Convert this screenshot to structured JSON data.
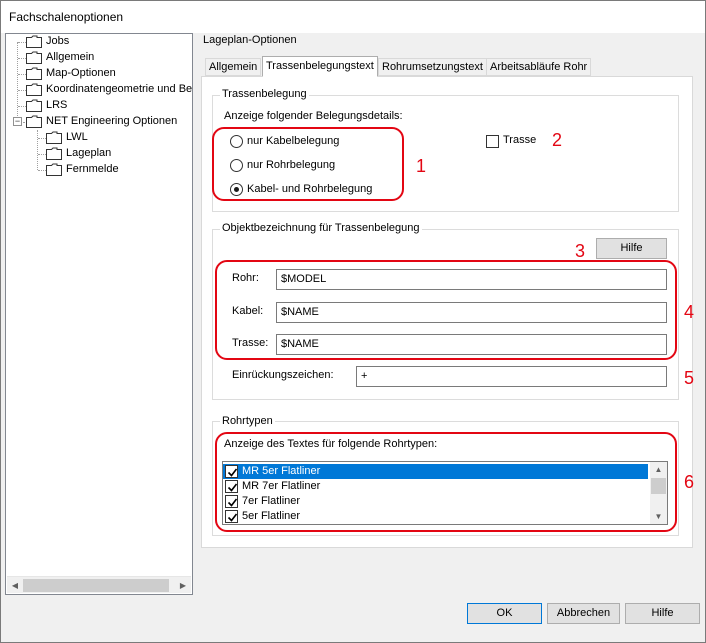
{
  "window": {
    "title": "Fachschalenoptionen"
  },
  "tree": {
    "items": [
      {
        "label": "Jobs"
      },
      {
        "label": "Allgemein"
      },
      {
        "label": "Map-Optionen"
      },
      {
        "label": "Koordinatengeometrie und Bem"
      },
      {
        "label": "LRS"
      },
      {
        "label": "NET Engineering Optionen"
      },
      {
        "label": "LWL"
      },
      {
        "label": "Lageplan"
      },
      {
        "label": "Fernmelde"
      }
    ],
    "expander": "−",
    "scroll_left": "◀",
    "scroll_right": "▶"
  },
  "group_title": "Lageplan-Optionen",
  "tabs": [
    {
      "label": "Allgemein"
    },
    {
      "label": "Trassenbelegungstext"
    },
    {
      "label": "Rohrumsetzungstext"
    },
    {
      "label": "Arbeitsabläufe Rohr"
    }
  ],
  "trassenbelegung": {
    "title": "Trassenbelegung",
    "prompt": "Anzeige folgender Belegungsdetails:",
    "options": [
      {
        "label": "nur Kabelbelegung"
      },
      {
        "label": "nur Rohrbelegung"
      },
      {
        "label": "Kabel- und Rohrbelegung"
      }
    ],
    "selected_option": "Kabel- und Rohrbelegung",
    "trasse_checkbox": {
      "label": "Trasse",
      "checked": false
    }
  },
  "objektbezeichnung": {
    "title": "Objektbezeichnung für Trassenbelegung",
    "hilfe_label": "Hilfe",
    "fields": {
      "rohr": {
        "label": "Rohr:",
        "value": "$MODEL"
      },
      "kabel": {
        "label": "Kabel:",
        "value": "$NAME"
      },
      "trasse": {
        "label": "Trasse:",
        "value": "$NAME"
      },
      "einrueckung": {
        "label": "Einrückungszeichen:",
        "value": "+"
      }
    }
  },
  "rohrtypen": {
    "title": "Rohrtypen",
    "prompt": "Anzeige des Textes für folgende Rohrtypen:",
    "items": [
      {
        "label": "MR 5er Flatliner",
        "checked": true,
        "selected": true
      },
      {
        "label": "MR 7er Flatliner",
        "checked": true,
        "selected": false
      },
      {
        "label": "7er Flatliner",
        "checked": true,
        "selected": false
      },
      {
        "label": "5er Flatliner",
        "checked": true,
        "selected": false
      }
    ],
    "scroll_up": "▲",
    "scroll_down": "▼"
  },
  "annotations": {
    "n1": "1",
    "n2": "2",
    "n3": "3",
    "n4": "4",
    "n5": "5",
    "n6": "6",
    "color": "#e30613"
  },
  "buttons": {
    "ok": "OK",
    "cancel": "Abbrechen",
    "help": "Hilfe"
  },
  "colors": {
    "accent": "#0078d7",
    "annotation_red": "#e30613"
  },
  "icons": {
    "folder": "folder-icon",
    "check": "checkmark-icon"
  }
}
